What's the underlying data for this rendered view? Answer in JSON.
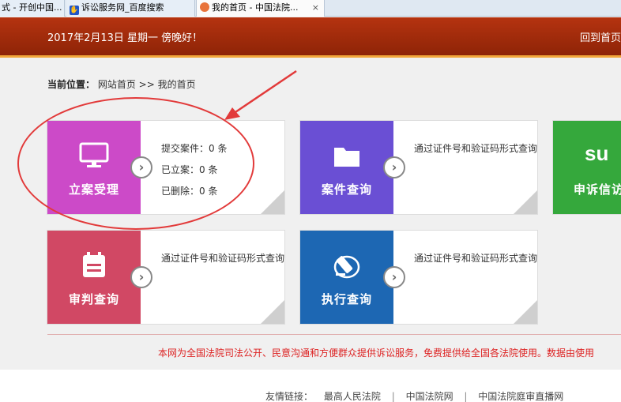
{
  "browser": {
    "tabs": [
      {
        "label": "式 - 开创中国..."
      },
      {
        "label": "诉讼服务网_百度搜索"
      },
      {
        "label": "我的首页 - 中国法院..."
      }
    ],
    "close_glyph": "×"
  },
  "header": {
    "date_greeting": "2017年2月13日 星期一 傍晚好！",
    "home_link": "回到首页"
  },
  "breadcrumb": {
    "label": "当前位置：",
    "path": "网站首页 >> 我的首页"
  },
  "cards": [
    {
      "title": "立案受理",
      "icon": "monitor-icon",
      "lines": [
        "提交案件：0 条",
        "已立案：0 条",
        "已删除：0 条"
      ]
    },
    {
      "title": "案件查询",
      "icon": "folder-icon",
      "desc": "通过证件号和验证码形式查询"
    },
    {
      "title": "申诉信访",
      "icon": "stumble-icon",
      "glyph": "su"
    },
    {
      "title": "审判查询",
      "icon": "calendar-icon",
      "desc": "通过证件号和验证码形式查询"
    },
    {
      "title": "执行查询",
      "icon": "gavel-icon",
      "desc": "通过证件号和验证码形式查询"
    }
  ],
  "arrow_glyph": "›",
  "notice": "本网为全国法院司法公开、民意沟通和方便群众提供诉讼服务，免费提供给全国各法院使用。数据由使用",
  "footer": {
    "label": "友情链接：",
    "links": [
      "最高人民法院",
      "中国法院网",
      "中国法院庭审直播网"
    ],
    "sep": "|"
  },
  "colors": {
    "header": "#a62c0c",
    "purple": "#cc4ac8",
    "violet": "#6a4fd4",
    "green": "#35a83c",
    "red": "#d14864",
    "blue": "#1d67b3",
    "annotation": "#e23a3a"
  }
}
